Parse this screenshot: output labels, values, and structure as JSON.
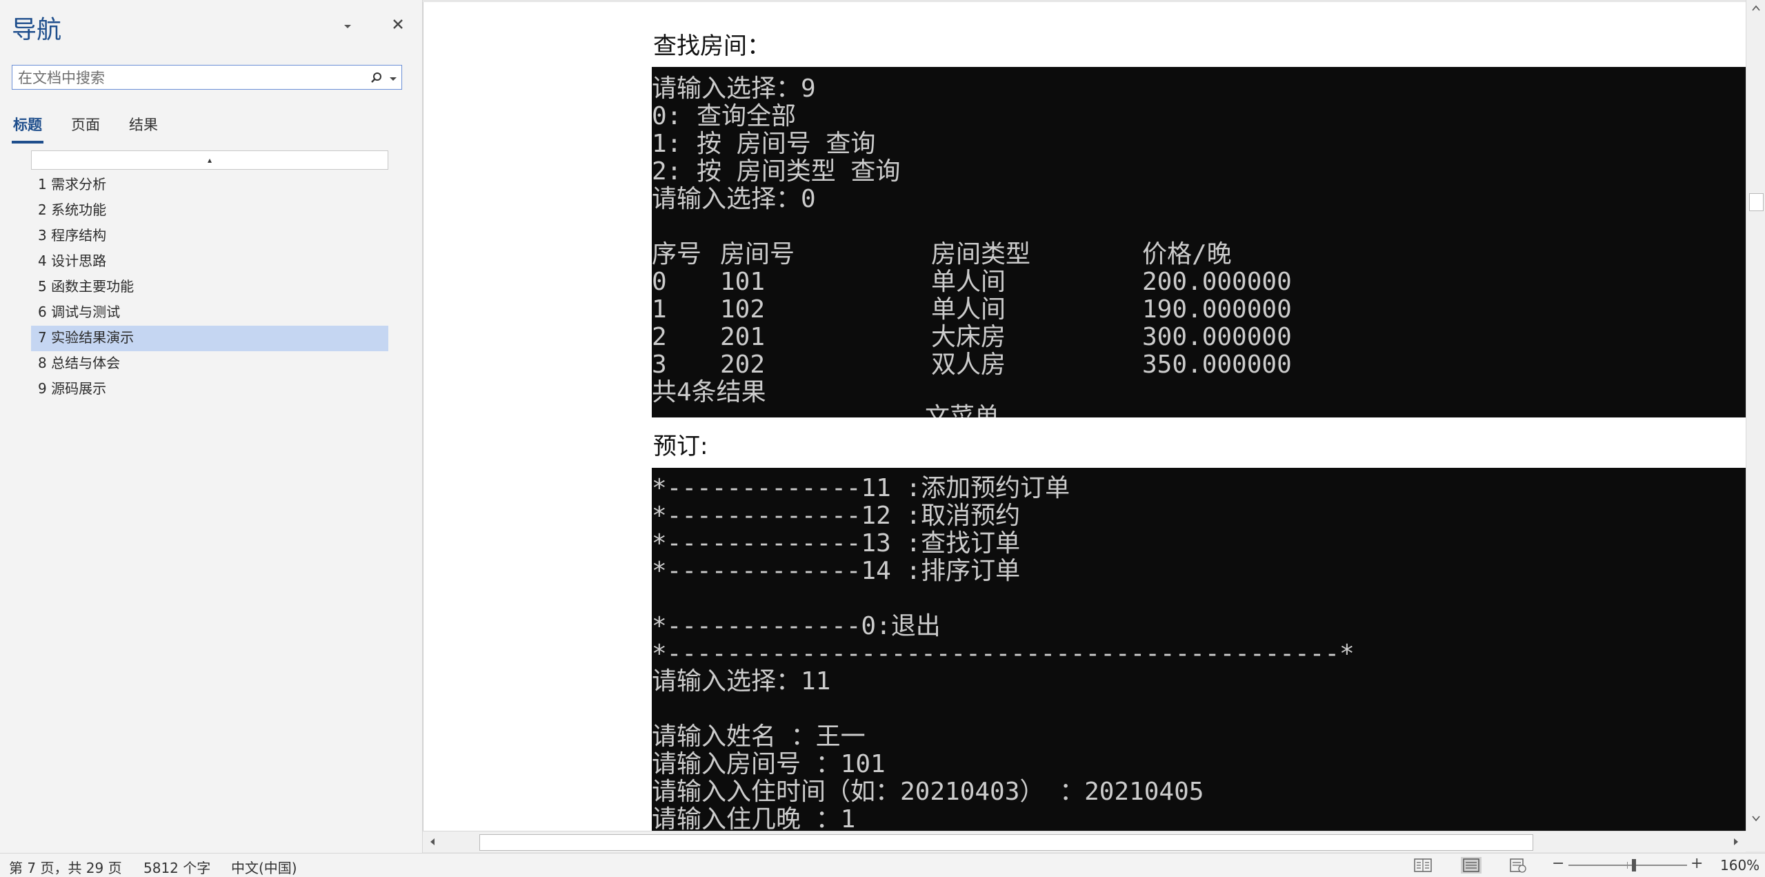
{
  "nav": {
    "title": "导航",
    "search_placeholder": "在文档中搜索",
    "tabs": [
      "标题",
      "页面",
      "结果"
    ],
    "collapse_symbol": "▴",
    "headings": [
      {
        "label": "1 需求分析",
        "active": false
      },
      {
        "label": "2 系统功能",
        "active": false
      },
      {
        "label": "3 程序结构",
        "active": false
      },
      {
        "label": "4 设计思路",
        "active": false
      },
      {
        "label": "5 函数主要功能",
        "active": false
      },
      {
        "label": "6 调试与测试",
        "active": false
      },
      {
        "label": "7 实验结果演示",
        "active": true
      },
      {
        "label": "8 总结与体会",
        "active": false
      },
      {
        "label": "9 源码展示",
        "active": false
      }
    ]
  },
  "document": {
    "para_find": "查找房间：",
    "para_book": "预订:",
    "console1": {
      "lines": [
        "请输入选择：9",
        "0: 查询全部",
        "1: 按 房间号 查询",
        "2: 按 房间类型 查询",
        "请输入选择：0"
      ],
      "table_header": [
        "序号",
        "房间号",
        "房间类型",
        "价格/晚"
      ],
      "rows": [
        [
          "0",
          "101",
          "单人间",
          "200.000000"
        ],
        [
          "1",
          "102",
          "单人间",
          "190.000000"
        ],
        [
          "2",
          "201",
          "大床房",
          "300.000000"
        ],
        [
          "3",
          "202",
          "双人房",
          "350.000000"
        ]
      ],
      "footer": "共4条结果",
      "clipped": "文菜单"
    },
    "console2": {
      "lines": [
        "*-------------11 :添加预约订单",
        "*-------------12 :取消预约",
        "*-------------13 :查找订单",
        "*-------------14 :排序订单",
        "",
        "*-------------0:退出",
        "*---------------------------------------------*",
        "请输入选择：11",
        "",
        "请输入姓名 ：王一",
        "请输入房间号 ：101",
        "请输入入住时间（如：20210403） ：20210405",
        "请输入住几晚 ：1"
      ]
    }
  },
  "status": {
    "page": "第 7 页，共 29 页",
    "words": "5812 个字",
    "language": "中文(中国)",
    "zoom_minus": "−",
    "zoom_plus": "+",
    "zoom": "160%"
  }
}
